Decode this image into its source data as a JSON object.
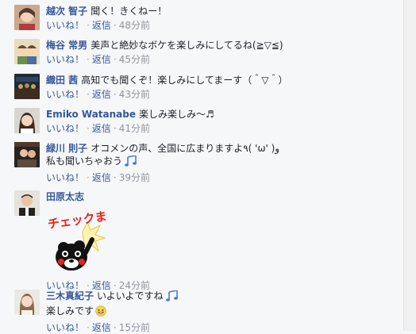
{
  "comments": [
    {
      "author": "越次 智子",
      "text": "聞く！きくねー！",
      "like": "いいね！",
      "reply": "返信",
      "time": "48分前"
    },
    {
      "author": "梅谷 常男",
      "text": "美声と絶妙なボケを楽しみにしてるね(≧▽≦)",
      "like": "いいね！",
      "reply": "返信",
      "time": "45分前"
    },
    {
      "author": "織田 茜",
      "text": "高知でも聞くぞ！楽しみにしてまーす（＾▽＾）",
      "like": "いいね！",
      "reply": "返信",
      "time": "43分前"
    },
    {
      "author": "Emiko Watanabe",
      "text": "楽しみ楽しみ〜♬",
      "like": "いいね！",
      "reply": "返信",
      "time": "41分前"
    },
    {
      "author": "緑川 則子",
      "text": "オコメンの声、全国に広まりますよ٩( 'ω' )و",
      "text2": "私も聞いちゃおう",
      "like": "いいね！",
      "reply": "返信",
      "time": "39分前"
    },
    {
      "author": "田原太志",
      "sticker_text": "チェックま",
      "like": "いいね！",
      "reply": "返信",
      "time": "24分前"
    },
    {
      "author": "三木真紀子",
      "text": "いよいよですね",
      "text2": "楽しみです",
      "like": "いいね！",
      "reply": "返信",
      "time": "15分前"
    }
  ],
  "colors": {
    "link": "#365899",
    "meta": "#90949c",
    "background": "#f6f7f9",
    "sticker_red": "#e4231f"
  },
  "icons": [
    "music-note-icon",
    "grin-emoji-icon",
    "kumamon-sticker"
  ]
}
